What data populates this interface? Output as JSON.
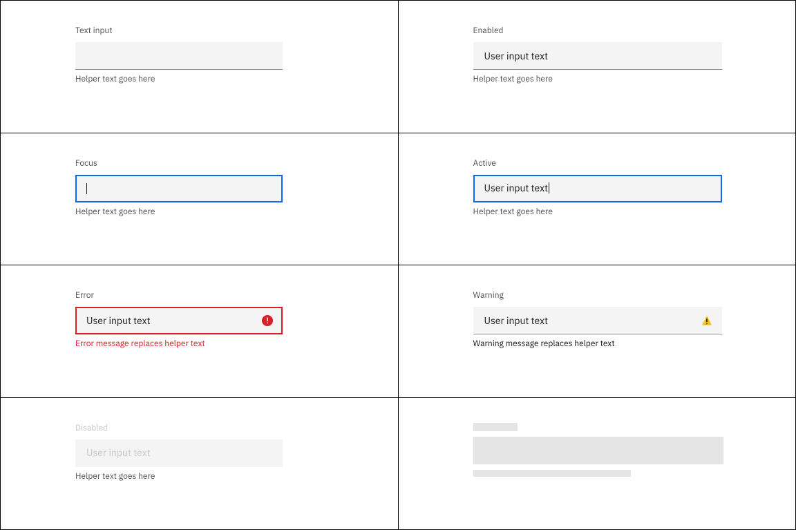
{
  "states": {
    "default": {
      "label": "Text input",
      "value": "",
      "helper": "Helper text goes here"
    },
    "enabled": {
      "label": "Enabled",
      "value": "User input text",
      "helper": "Helper text goes here"
    },
    "focus": {
      "label": "Focus",
      "value": "",
      "helper": "Helper text goes here"
    },
    "active": {
      "label": "Active",
      "value": "User input text",
      "helper": "Helper text goes here"
    },
    "error": {
      "label": "Error",
      "value": "User input text",
      "helper": "Error message replaces helper text"
    },
    "warning": {
      "label": "Warning",
      "value": "User input text",
      "helper": "Warning message replaces helper text"
    },
    "disabled": {
      "label": "Disabled",
      "value": "User input text",
      "helper": "Helper text goes here"
    }
  },
  "colors": {
    "focus": "#0f62fe",
    "error": "#da1e28",
    "warning": "#f1c21b",
    "field": "#f4f4f4",
    "border": "#8d8d8d",
    "text": "#161616"
  }
}
